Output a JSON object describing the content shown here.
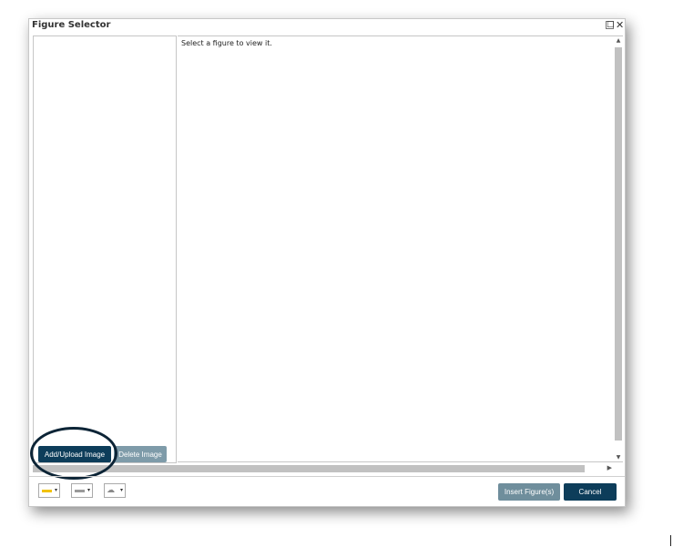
{
  "dialog": {
    "title": "Figure Selector",
    "maximize_glyph": "□",
    "close_glyph": "✕"
  },
  "main": {
    "placeholder_text": "Select a figure to view it."
  },
  "left_panel": {
    "add_button_label": "Add/Upload Image",
    "delete_button_label": "Delete Image"
  },
  "toolbar": {
    "tools": [
      {
        "icon": "highlight-color-icon",
        "color": "#f2c200"
      },
      {
        "icon": "line-style-icon",
        "color": "#9a9a9a"
      },
      {
        "icon": "shape-icon",
        "color": "#8a8a8a"
      }
    ],
    "caret_glyph": "▾"
  },
  "footer": {
    "insert_label": "Insert Figure(s)",
    "cancel_label": "Cancel"
  },
  "colors": {
    "primary_button": "#0d3d5a",
    "disabled_button": "#7e9ba9",
    "annotation_ring": "#0c2436"
  }
}
